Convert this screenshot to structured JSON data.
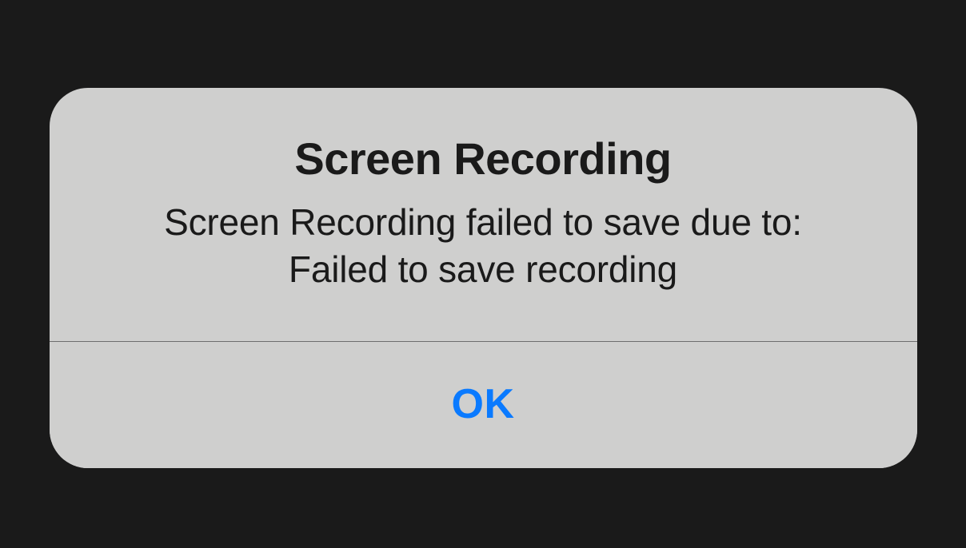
{
  "alert": {
    "title": "Screen Recording",
    "message_line1": "Screen Recording failed to save due to:",
    "message_line2": "Failed to save recording",
    "ok_label": "OK"
  }
}
